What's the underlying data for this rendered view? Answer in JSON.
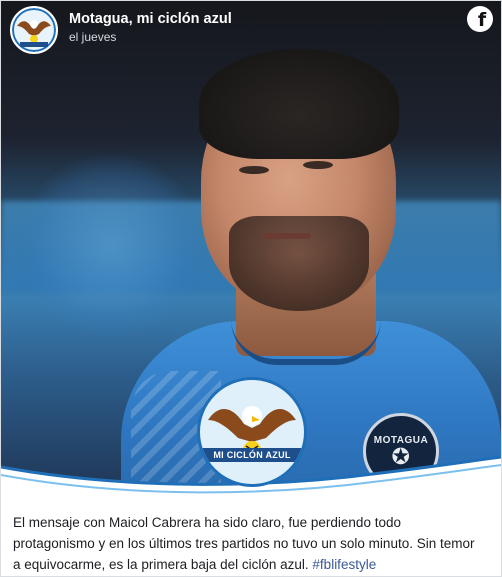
{
  "header": {
    "page_name": "Motagua, mi ciclón azul",
    "timestamp": "el jueves",
    "platform_icon": "facebook-icon"
  },
  "image": {
    "watermark_text": "MI CICLÓN AZUL",
    "crest_text": "MOTAGUA"
  },
  "caption": {
    "text": "El mensaje con Maicol Cabrera ha sido claro, fue perdiendo todo protagonismo y en los últimos tres partidos no tuvo un solo minuto. Sin temor a equivocarme, es la primera baja del ciclón azul.",
    "hashtag": "#fblifestyle"
  },
  "colors": {
    "hashtag": "#3a5998",
    "text": "#1c1e21",
    "jersey": "#2f78c2"
  }
}
